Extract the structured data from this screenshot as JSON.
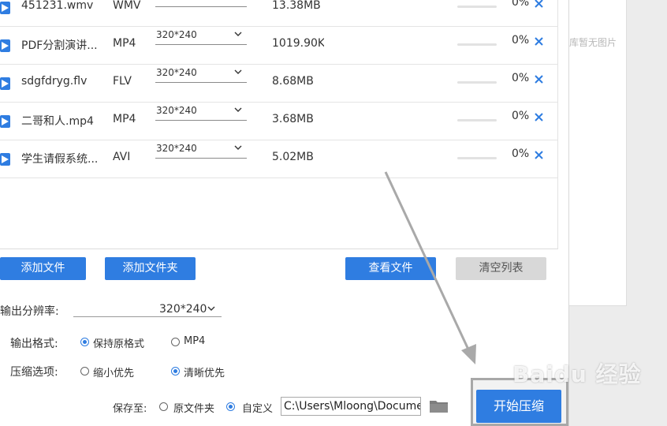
{
  "side_panel": {
    "text": "库暂无图片"
  },
  "files": [
    {
      "name": "451231.wmv",
      "type": "WMV",
      "resolution": "320*240",
      "size": "13.38MB",
      "progress": 0,
      "percent": "0%"
    },
    {
      "name": "PDF分割演讲...",
      "type": "MP4",
      "resolution": "320*240",
      "size": "1019.90KB",
      "progress": 0,
      "percent": "0%"
    },
    {
      "name": "sdgfdryg.flv",
      "type": "FLV",
      "resolution": "320*240",
      "size": "8.68MB",
      "progress": 0,
      "percent": "0%"
    },
    {
      "name": "二哥和人.mp4",
      "type": "MP4",
      "resolution": "320*240",
      "size": "3.68MB",
      "progress": 0,
      "percent": "0%"
    },
    {
      "name": "学生请假系统...",
      "type": "AVI",
      "resolution": "320*240",
      "size": "5.02MB",
      "progress": 0,
      "percent": "0%"
    }
  ],
  "buttons": {
    "add_file": "添加文件",
    "add_folder": "添加文件夹",
    "view_file": "查看文件",
    "clear_list": "清空列表",
    "start": "开始压缩"
  },
  "settings": {
    "resolution_label": "输出分辨率:",
    "resolution_value": "320*240",
    "format_label": "输出格式:",
    "format_options": [
      "保持原格式",
      "MP4"
    ],
    "compress_label": "压缩选项:",
    "compress_options": [
      "缩小优先",
      "清晰优先"
    ],
    "save_label": "保存至:",
    "save_options": [
      "原文件夹",
      "自定义"
    ],
    "save_path": "C:\\Users\\Mloong\\Documents"
  },
  "watermark": "Baidu 经验",
  "colors": {
    "accent": "#2f7de1",
    "gray_button": "#d8d8d8"
  }
}
